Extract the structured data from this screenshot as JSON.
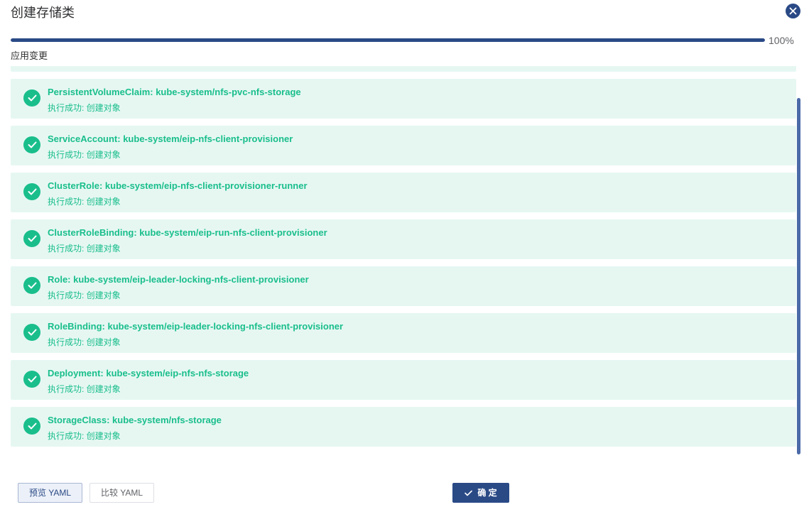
{
  "dialog": {
    "title": "创建存储类",
    "close_icon": "close-icon"
  },
  "progress": {
    "percent_value": 100,
    "percent_text": "100%",
    "bar_color": "#2a4a86"
  },
  "section": {
    "label": "应用变更"
  },
  "changes": {
    "status_color": "#19be8b",
    "background_color": "#e6f7f2",
    "items": [
      {
        "name": "PersistentVolumeClaim: kube-system/nfs-pvc-nfs-storage",
        "status": "执行成功: 创建对象"
      },
      {
        "name": "ServiceAccount: kube-system/eip-nfs-client-provisioner",
        "status": "执行成功: 创建对象"
      },
      {
        "name": "ClusterRole: kube-system/eip-nfs-client-provisioner-runner",
        "status": "执行成功: 创建对象"
      },
      {
        "name": "ClusterRoleBinding: kube-system/eip-run-nfs-client-provisioner",
        "status": "执行成功: 创建对象"
      },
      {
        "name": "Role: kube-system/eip-leader-locking-nfs-client-provisioner",
        "status": "执行成功: 创建对象"
      },
      {
        "name": "RoleBinding: kube-system/eip-leader-locking-nfs-client-provisioner",
        "status": "执行成功: 创建对象"
      },
      {
        "name": "Deployment: kube-system/eip-nfs-nfs-storage",
        "status": "执行成功: 创建对象"
      },
      {
        "name": "StorageClass: kube-system/nfs-storage",
        "status": "执行成功: 创建对象"
      }
    ]
  },
  "footer": {
    "preview_label": "预览 YAML",
    "compare_label": "比较 YAML",
    "confirm_label": "确 定",
    "confirm_icon": "check-icon",
    "accent_color": "#2a4a86"
  }
}
